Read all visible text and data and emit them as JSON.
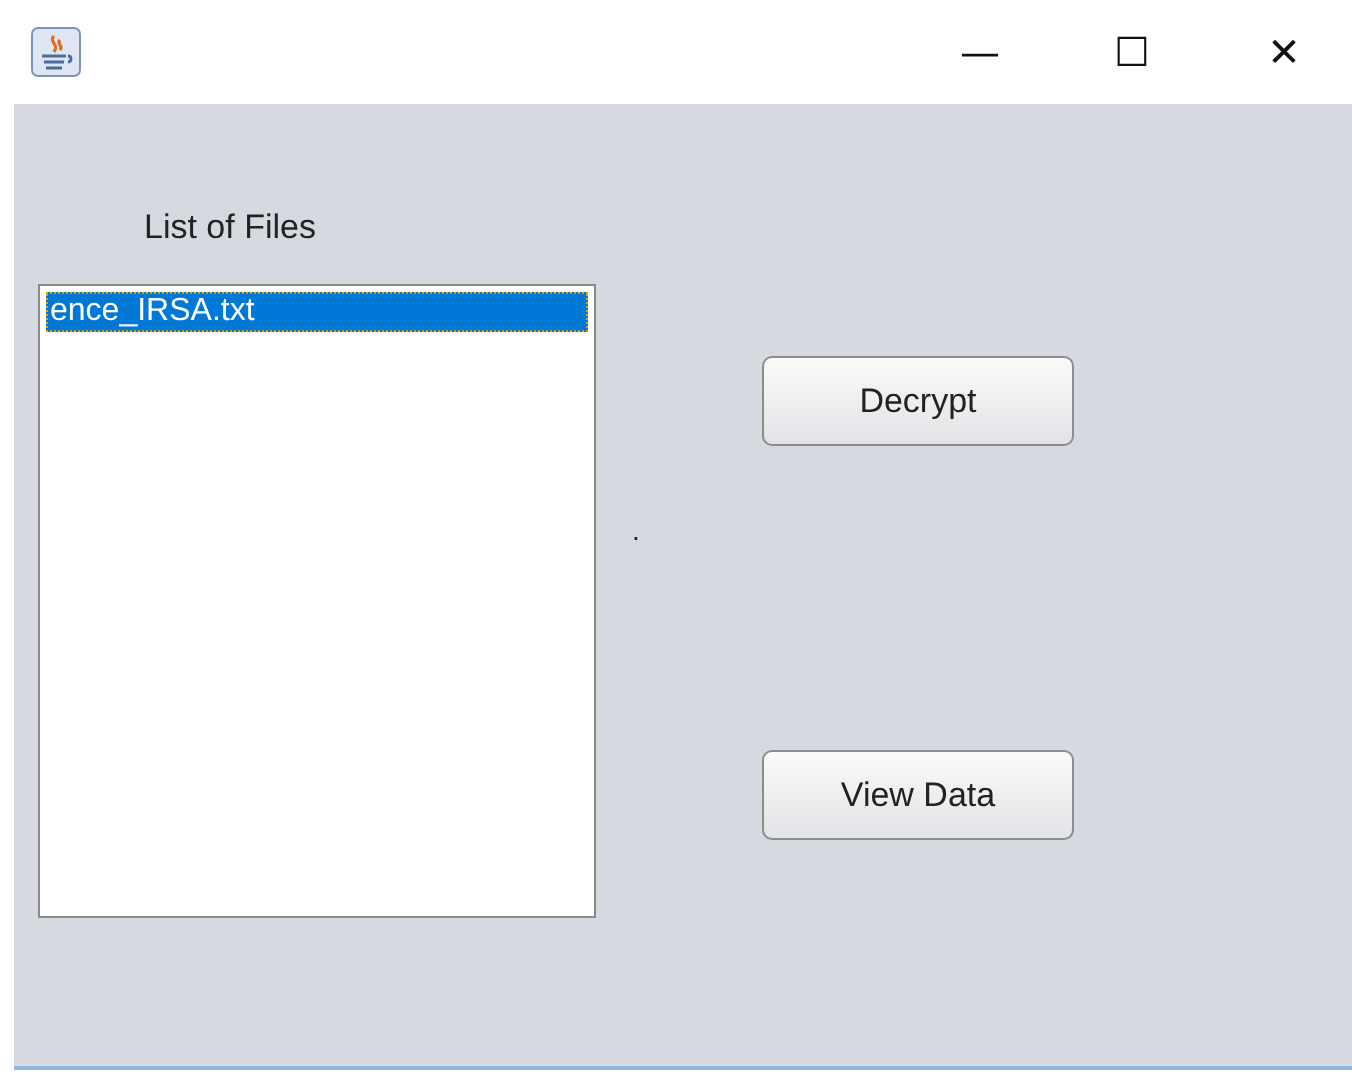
{
  "window": {
    "title_buttons": [
      "—",
      "☐",
      "✕"
    ]
  },
  "list_label": "List of Files",
  "files": [
    {
      "name": "ence_IRSA.txt",
      "selected": true
    }
  ],
  "status_label": ".",
  "buttons": [
    "Decrypt",
    "View Data"
  ]
}
